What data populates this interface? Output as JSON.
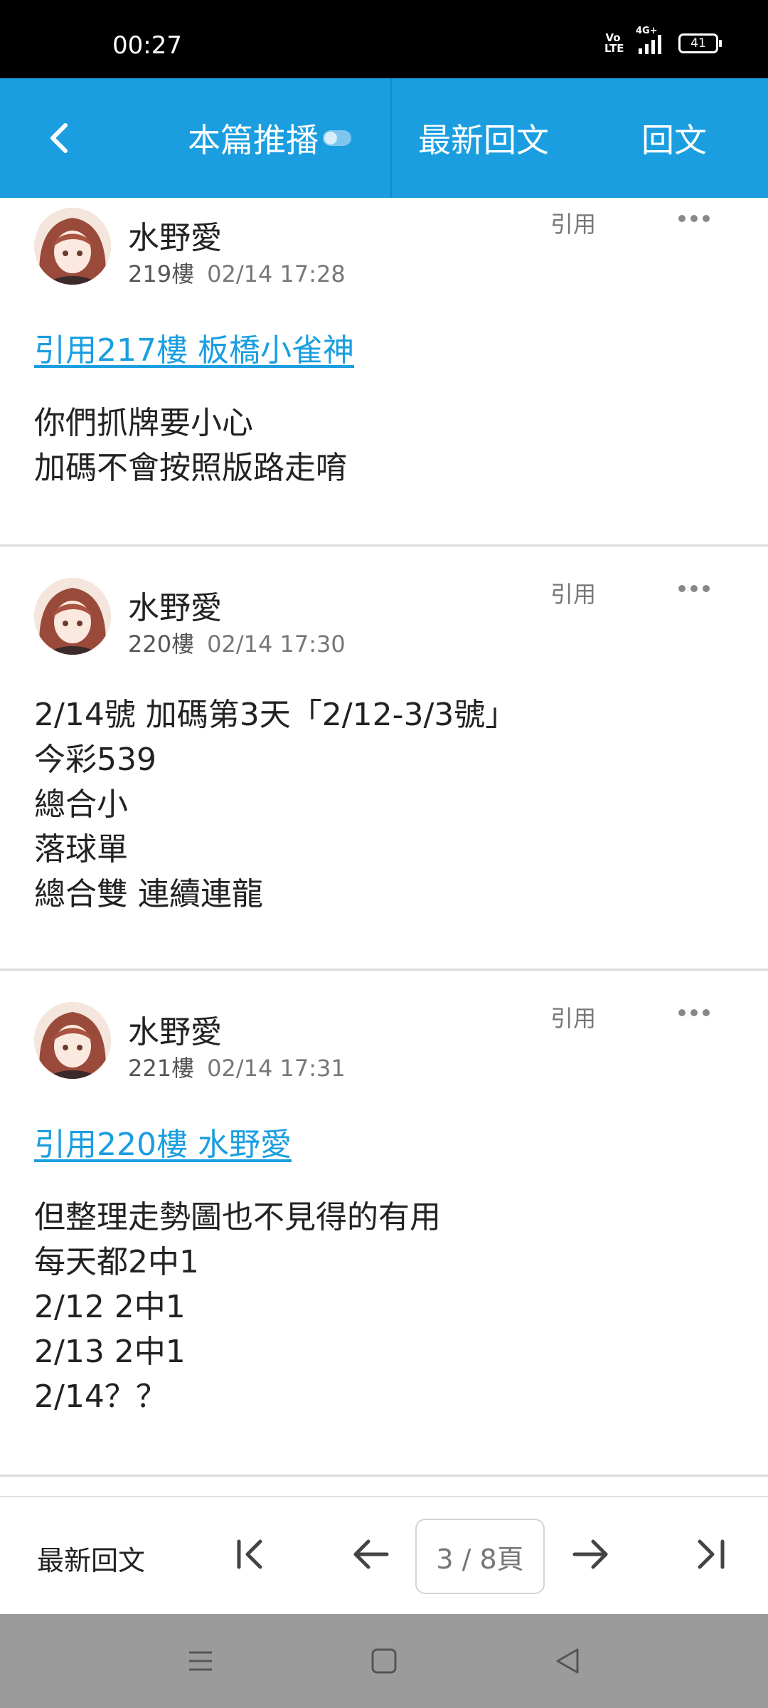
{
  "status_bar": {
    "time": "00:27",
    "volte": "Vo LTE",
    "network": "4G+",
    "battery": "41"
  },
  "header": {
    "tab_push": "本篇推播",
    "tab_latest": "最新回文",
    "tab_reply": "回文"
  },
  "posts": [
    {
      "author": "水野愛",
      "floor": "219樓",
      "date": "02/14 17:28",
      "quote_btn": "引用",
      "quote_link": "引用217樓 板橋小雀神",
      "lines": [
        "你們抓牌要小心",
        "加碼不會按照版路走唷"
      ]
    },
    {
      "author": "水野愛",
      "floor": "220樓",
      "date": "02/14 17:30",
      "quote_btn": "引用",
      "lines": [
        "2/14號 加碼第3天「2/12-3/3號」",
        "今彩539",
        "總合小",
        "落球單",
        "總合雙 連續連龍"
      ]
    },
    {
      "author": "水野愛",
      "floor": "221樓",
      "date": "02/14 17:31",
      "quote_btn": "引用",
      "quote_link": "引用220樓 水野愛",
      "lines": [
        "但整理走勢圖也不見得的有用",
        "每天都2中1",
        "2/12 2中1",
        "2/13 2中1",
        "2/14？？"
      ]
    }
  ],
  "bottom_bar": {
    "latest_label": "最新回文",
    "page_indicator": "3 / 8頁"
  },
  "icons": {
    "back": "chevron-left-icon",
    "more": "more-dots-icon",
    "first": "first-page-icon",
    "prev": "arrow-left-icon",
    "next": "arrow-right-icon",
    "last": "last-page-icon",
    "nav_menu": "menu-icon",
    "nav_home": "home-square-icon",
    "nav_back": "back-triangle-icon"
  },
  "colors": {
    "accent": "#1a9ee0",
    "status_bar": "#000000",
    "nav_bar": "#9b9b9b"
  }
}
